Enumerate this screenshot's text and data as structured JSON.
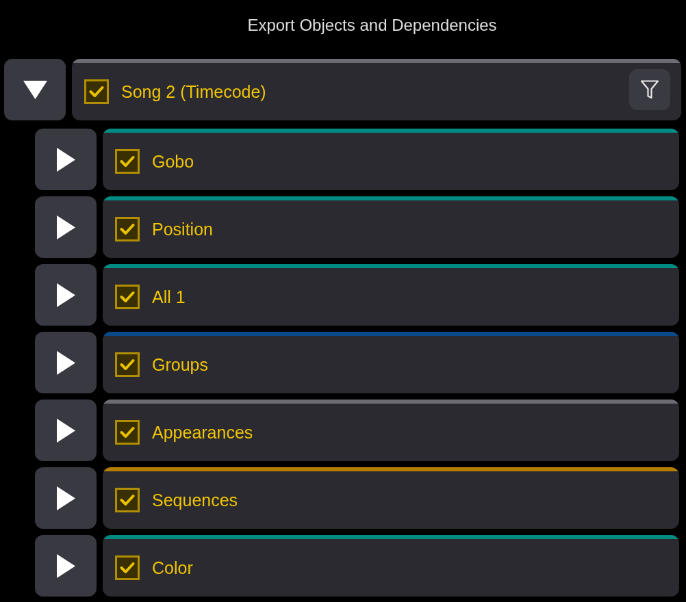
{
  "title": "Export Objects and Dependencies",
  "tree": {
    "label": "Song 2 (Timecode)",
    "checked": true,
    "expanded": true,
    "color": "#6c6c74",
    "children": [
      {
        "label": "Gobo",
        "checked": true,
        "expanded": false,
        "color": "#008a84"
      },
      {
        "label": "Position",
        "checked": true,
        "expanded": false,
        "color": "#008a84"
      },
      {
        "label": "All 1",
        "checked": true,
        "expanded": false,
        "color": "#008a84"
      },
      {
        "label": "Groups",
        "checked": true,
        "expanded": false,
        "color": "#0b4a8a"
      },
      {
        "label": "Appearances",
        "checked": true,
        "expanded": false,
        "color": "#6c6c74"
      },
      {
        "label": "Sequences",
        "checked": true,
        "expanded": false,
        "color": "#b37d00"
      },
      {
        "label": "Color",
        "checked": true,
        "expanded": false,
        "color": "#008a84"
      }
    ]
  }
}
